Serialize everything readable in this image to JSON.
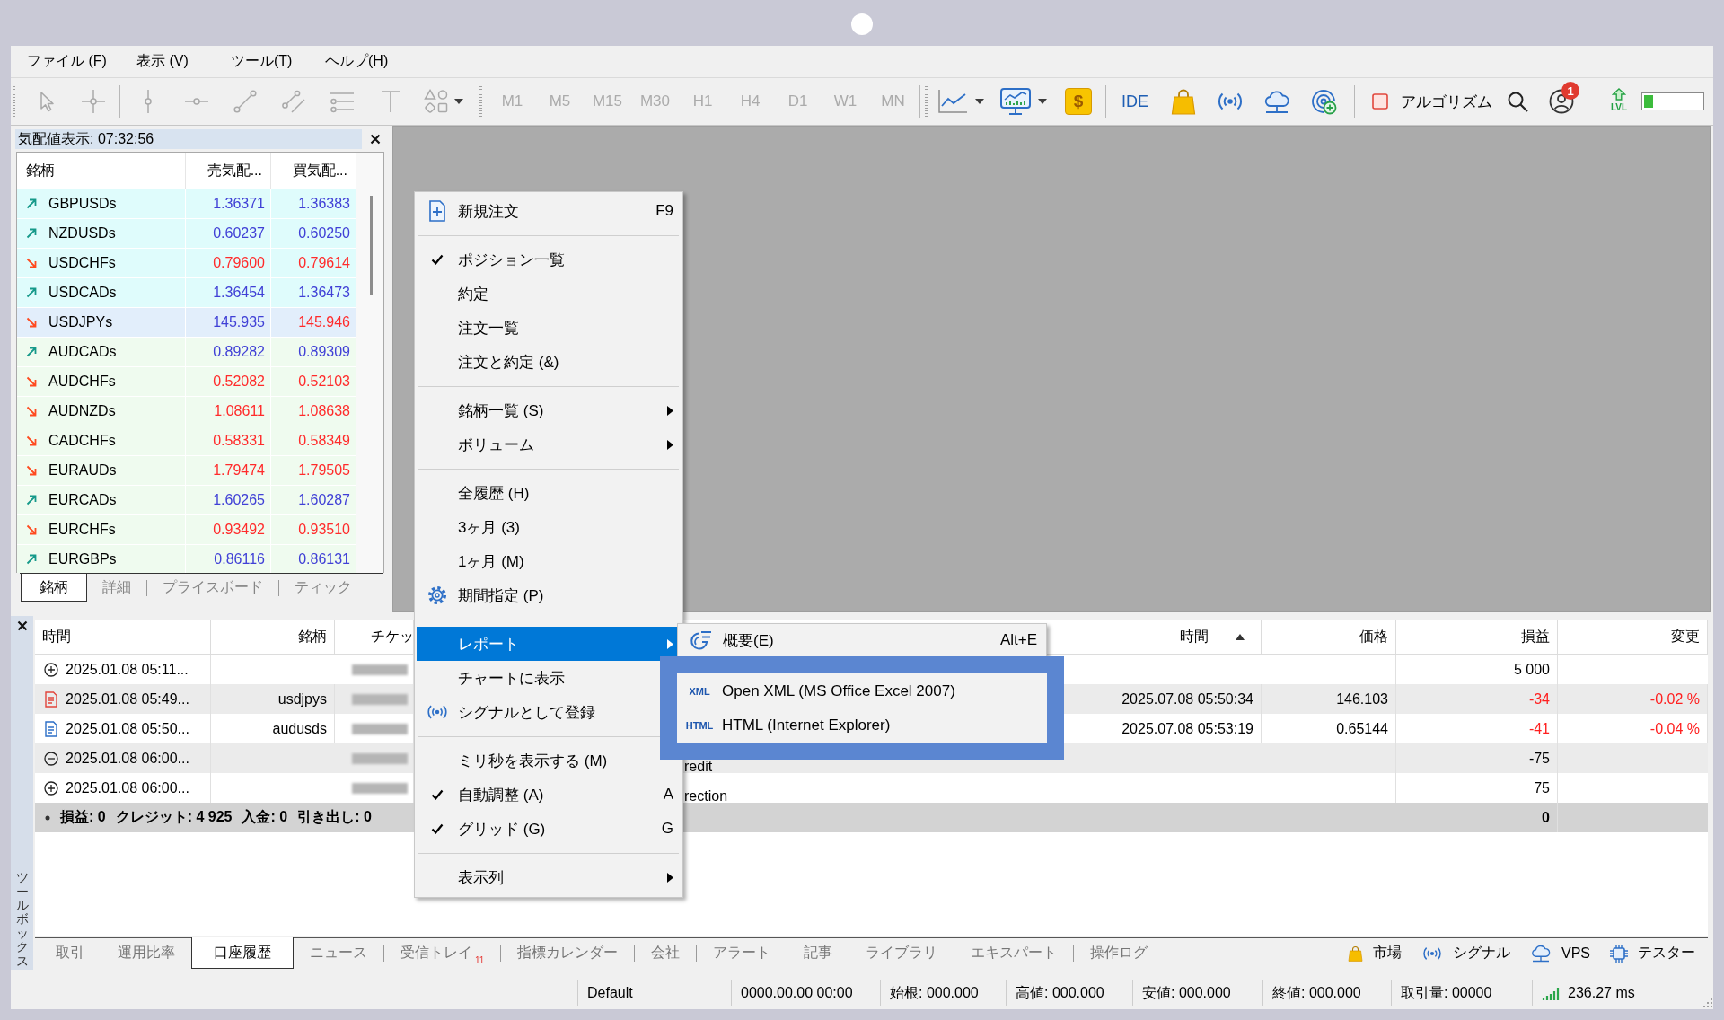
{
  "menu_bar": [
    "ファイル (F)",
    "表示 (V)",
    "ツール(T)",
    "ヘルプ(H)"
  ],
  "toolbar": {
    "tools_disabled": true,
    "timeframes": [
      {
        "label": "M1",
        "disabled": true
      },
      {
        "label": "M5",
        "disabled": true
      },
      {
        "label": "M15",
        "disabled": true
      },
      {
        "label": "M30",
        "disabled": true
      },
      {
        "label": "H1",
        "disabled": true
      },
      {
        "label": "H4",
        "disabled": true
      },
      {
        "label": "D1",
        "disabled": true
      },
      {
        "label": "W1",
        "disabled": true
      },
      {
        "label": "MN",
        "disabled": true
      }
    ],
    "deposit_label": "$",
    "ide_label": "IDE",
    "algo_trading": {
      "label": "アルゴリズム",
      "on": false
    },
    "notifications": "1",
    "level_label": "LVL",
    "level_meter": {
      "level": 0.15
    }
  },
  "market_watch": {
    "title": "気配値表示: 07:32:56",
    "columns": [
      "銘柄",
      "売気配...",
      "買気配..."
    ],
    "rows": [
      {
        "symbol": "GBPUSDs",
        "rising": true,
        "bid": "1.36371",
        "bid_rising": true,
        "ask": "1.36383",
        "ask_rising": true,
        "color": "#dffcfc"
      },
      {
        "symbol": "NZDUSDs",
        "rising": true,
        "bid": "0.60237",
        "bid_rising": true,
        "ask": "0.60250",
        "ask_rising": true,
        "color": "#dffcfc"
      },
      {
        "symbol": "USDCHFs",
        "rising": false,
        "bid": "0.79600",
        "bid_rising": false,
        "ask": "0.79614",
        "ask_rising": false,
        "color": "#dffcfc"
      },
      {
        "symbol": "USDCADs",
        "rising": true,
        "bid": "1.36454",
        "bid_rising": true,
        "ask": "1.36473",
        "ask_rising": true,
        "color": "#dffcfc"
      },
      {
        "symbol": "USDJPYs",
        "rising": false,
        "bid": "145.935",
        "bid_rising": true,
        "ask": "145.946",
        "ask_rising": false,
        "color": "#e2eefb"
      },
      {
        "symbol": "AUDCADs",
        "rising": true,
        "bid": "0.89282",
        "bid_rising": true,
        "ask": "0.89309",
        "ask_rising": true,
        "color": "#effbef"
      },
      {
        "symbol": "AUDCHFs",
        "rising": false,
        "bid": "0.52082",
        "bid_rising": false,
        "ask": "0.52103",
        "ask_rising": false,
        "color": "#effbef"
      },
      {
        "symbol": "AUDNZDs",
        "rising": false,
        "bid": "1.08611",
        "bid_rising": false,
        "ask": "1.08638",
        "ask_rising": false,
        "color": "#effbef"
      },
      {
        "symbol": "CADCHFs",
        "rising": false,
        "bid": "0.58331",
        "bid_rising": false,
        "ask": "0.58349",
        "ask_rising": false,
        "color": "#effbef"
      },
      {
        "symbol": "EURAUDs",
        "rising": false,
        "bid": "1.79474",
        "bid_rising": false,
        "ask": "1.79505",
        "ask_rising": false,
        "color": "#effbef"
      },
      {
        "symbol": "EURCADs",
        "rising": true,
        "bid": "1.60265",
        "bid_rising": true,
        "ask": "1.60287",
        "ask_rising": true,
        "color": "#effbef"
      },
      {
        "symbol": "EURCHFs",
        "rising": false,
        "bid": "0.93492",
        "bid_rising": false,
        "ask": "0.93510",
        "ask_rising": false,
        "color": "#effbef"
      },
      {
        "symbol": "EURGBPs",
        "rising": true,
        "bid": "0.86116",
        "bid_rising": true,
        "ask": "0.86131",
        "ask_rising": true,
        "color": "#effbef"
      }
    ],
    "tabs": [
      {
        "label": "銘柄",
        "selected": true
      },
      {
        "label": "詳細",
        "selected": false
      },
      {
        "label": "プライスボード",
        "selected": false
      },
      {
        "label": "ティック",
        "selected": false
      }
    ]
  },
  "context_menu": {
    "groups": [
      {
        "items": [
          {
            "kind": "order",
            "label": "新規注文",
            "shortcut": "F9",
            "checked": false,
            "submenu": false,
            "selected": false
          }
        ]
      },
      {
        "items": [
          {
            "kind": "plain",
            "label": "ポジション一覧",
            "checked": true,
            "submenu": false,
            "selected": false
          },
          {
            "kind": "plain",
            "label": "約定",
            "checked": false,
            "submenu": false,
            "selected": false
          },
          {
            "kind": "plain",
            "label": "注文一覧",
            "checked": false,
            "submenu": false,
            "selected": false
          },
          {
            "kind": "plain",
            "label": "注文と約定 (&)",
            "checked": false,
            "submenu": false,
            "selected": false
          }
        ]
      },
      {
        "items": [
          {
            "kind": "plain",
            "label": "銘柄一覧 (S)",
            "checked": false,
            "submenu": true,
            "selected": false
          },
          {
            "kind": "plain",
            "label": "ボリューム",
            "checked": false,
            "submenu": true,
            "selected": false
          }
        ]
      },
      {
        "items": [
          {
            "kind": "plain",
            "label": "全履歴 (H)",
            "checked": false,
            "submenu": false,
            "selected": false
          },
          {
            "kind": "plain",
            "label": "3ヶ月 (3)",
            "checked": false,
            "submenu": false,
            "selected": false
          },
          {
            "kind": "plain",
            "label": "1ヶ月 (M)",
            "checked": false,
            "submenu": false,
            "selected": false
          },
          {
            "kind": "period",
            "label": "期間指定 (P)",
            "checked": false,
            "submenu": false,
            "selected": false
          }
        ]
      },
      {
        "items": [
          {
            "kind": "plain",
            "label": "レポート",
            "checked": false,
            "submenu": true,
            "selected": true
          },
          {
            "kind": "plain",
            "label": "チャートに表示",
            "checked": false,
            "submenu": false,
            "selected": false
          },
          {
            "kind": "signal",
            "label": "シグナルとして登録",
            "checked": false,
            "submenu": false,
            "selected": false
          }
        ]
      },
      {
        "items": [
          {
            "kind": "plain",
            "label": "ミリ秒を表示する (M)",
            "checked": false,
            "submenu": false,
            "selected": false
          },
          {
            "kind": "plain",
            "label": "自動調整 (A)",
            "shortcut": "A",
            "checked": true,
            "submenu": false,
            "selected": false
          },
          {
            "kind": "plain",
            "label": "グリッド (G)",
            "shortcut": "G",
            "checked": true,
            "submenu": false,
            "selected": false
          }
        ]
      },
      {
        "items": [
          {
            "kind": "plain",
            "label": "表示列",
            "checked": false,
            "submenu": true,
            "selected": false
          }
        ]
      }
    ]
  },
  "submenu": {
    "items": [
      {
        "kind": "summary",
        "label": "概要(E)",
        "shortcut": "Alt+E",
        "highlighted": false
      },
      {
        "kind": "export",
        "tag": "XML",
        "label": "Open XML (MS Office Excel 2007)",
        "highlighted": true
      },
      {
        "kind": "export",
        "tag": "HTML",
        "label": "HTML (Internet Explorer)",
        "highlighted": true
      }
    ]
  },
  "toolbox": {
    "title": "ツールボックス",
    "columns": [
      {
        "label": "時間",
        "sorted": false
      },
      {
        "label": "銘柄",
        "sorted": false
      },
      {
        "label": "チケッ"
      },
      {
        "label": "時間",
        "sorted": true
      },
      {
        "label": "価格",
        "sorted": false
      },
      {
        "label": "損益",
        "sorted": false
      },
      {
        "label": "変更",
        "sorted": false
      }
    ],
    "rows": [
      {
        "kind": "deposit",
        "time": "2025.01.08 05:11...",
        "redacted": true,
        "profit": "5 000",
        "loss": false
      },
      {
        "kind": "sell",
        "time": "2025.01.08 05:49...",
        "symbol": "usdjpys",
        "redacted": true,
        "close_time": "2025.07.08 05:50:34",
        "price": "146.103",
        "profit": "-34",
        "change": "-0.02 %",
        "loss": true
      },
      {
        "kind": "buy",
        "time": "2025.01.08 05:50...",
        "symbol": "audusds",
        "redacted": true,
        "close_time": "2025.07.08 05:53:19",
        "price": "0.65144",
        "profit": "-41",
        "change": "-0.04 %",
        "loss": true
      },
      {
        "kind": "withdrawal",
        "time": "2025.01.08 06:00...",
        "redacted": true,
        "comment": "redit",
        "profit": "-75",
        "loss": false
      },
      {
        "kind": "deposit",
        "time": "2025.01.08 06:00...",
        "redacted": true,
        "comment": "rection",
        "profit": "75",
        "loss": false
      }
    ],
    "summary": {
      "items": [
        "損益: 0",
        "クレジット: 4 925",
        "入金: 0",
        "引き出し: 0"
      ],
      "profit": "0"
    },
    "tabs": [
      {
        "label": "取引",
        "selected": false
      },
      {
        "label": "運用比率",
        "selected": false
      },
      {
        "label": "口座履歴",
        "selected": true
      },
      {
        "label": "ニュース",
        "selected": false
      },
      {
        "label": "受信トレイ",
        "badge": "11",
        "selected": false
      },
      {
        "label": "指標カレンダー",
        "selected": false
      },
      {
        "label": "会社",
        "selected": false
      },
      {
        "label": "アラート",
        "selected": false
      },
      {
        "label": "記事",
        "selected": false
      },
      {
        "label": "ライブラリ",
        "selected": false
      },
      {
        "label": "エキスパート",
        "selected": false
      },
      {
        "label": "操作ログ",
        "selected": false
      }
    ],
    "services": [
      {
        "kind": "market",
        "label": "市場"
      },
      {
        "kind": "signals",
        "label": "シグナル"
      },
      {
        "kind": "vps",
        "label": "VPS"
      },
      {
        "kind": "tester",
        "label": "テスター"
      }
    ]
  },
  "status_bar": {
    "cells": [
      "Default",
      "0000.00.00 00:00",
      "始根: 000.000",
      "高値: 000.000",
      "安値: 000.000",
      "終値: 000.000",
      "取引量: 00000"
    ],
    "ping": "236.27 ms"
  }
}
